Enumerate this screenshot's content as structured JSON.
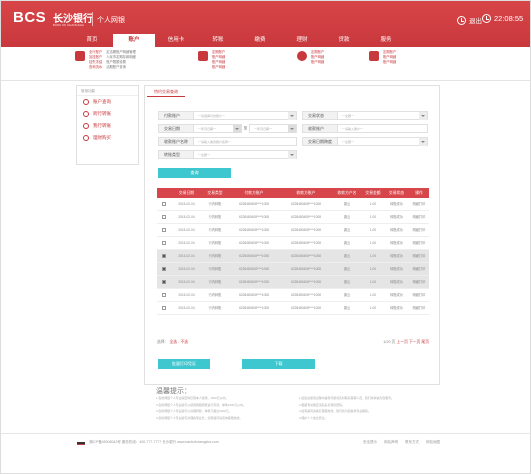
{
  "brand": {
    "logo": "BCS",
    "name_cn": "长沙银行",
    "name_en": "BANK OF CHANGSHA",
    "subtitle": "个人网银",
    "accent": "#c8383c",
    "teal": "#3fc7cf"
  },
  "header": {
    "exit_label": "退出",
    "time": "22:08:55"
  },
  "nav": {
    "items": [
      {
        "label": "首页"
      },
      {
        "label": "账户"
      },
      {
        "label": "信用卡"
      },
      {
        "label": "转账"
      },
      {
        "label": "缴费"
      },
      {
        "label": "理财"
      },
      {
        "label": "贷款"
      },
      {
        "label": "服务"
      }
    ],
    "active": 1
  },
  "submenu": {
    "group1_a": [
      "全行账户",
      "加挂账户",
      "挂失冻结",
      "查询流水"
    ],
    "group1_b": [
      "定活期账户明细管理",
      "人民币定期存款明细",
      "账户限额设置",
      "活期账户查询"
    ],
    "group2": [
      "定期账户",
      "账户明细",
      "账户明细",
      "账户明细"
    ],
    "group3": [
      "定期账户",
      "账户明细",
      "账户明细"
    ],
    "group4": [
      "定期账户",
      "账户明细",
      "账户明细"
    ]
  },
  "sidebar": {
    "title": "常用功能",
    "items": [
      {
        "label": "账户查询"
      },
      {
        "label": "跨行转账"
      },
      {
        "label": "我行转账"
      },
      {
        "label": "理财购买"
      }
    ]
  },
  "main": {
    "tab_label": "特约交易查询",
    "form": {
      "payer_label": "付款账户",
      "payer_placeholder": "一请选择付款账户一",
      "status_label": "交易状态",
      "status_placeholder": "一全部一",
      "date_label": "交易日期",
      "date_from_placeholder": "一年月日期一",
      "date_to_placeholder": "一年月日期一",
      "date_sep": "至",
      "payee_label": "收款账户",
      "payee_placeholder": "一请输入账户一",
      "payee_name_label": "收款账户名称",
      "payee_name_placeholder": "一请输入收款账户名称一",
      "date_period_label": "交易日期跨度",
      "date_period_placeholder": "一全部一",
      "transfer_type_label": "转账类型",
      "transfer_type_placeholder": "一全部一",
      "query_button": "查询"
    },
    "table": {
      "headers": [
        "交易日期",
        "交易类型",
        "付款方账户",
        "收款方账户",
        "收款方户名",
        "交易金额",
        "交易状态",
        "操作"
      ],
      "rows": [
        {
          "date": "2015-02-04",
          "type": "行内转账",
          "payer": "6228480408****1008",
          "payee": "6228480408****1008",
          "name": "唐云",
          "amount": "1.00",
          "status": "转账成功",
          "op": "明细打印",
          "checked": false
        },
        {
          "date": "2015-02-04",
          "type": "行内转账",
          "payer": "6228480408****1008",
          "payee": "6228480408****1008",
          "name": "唐云",
          "amount": "1.00",
          "status": "转账成功",
          "op": "明细打印",
          "checked": false
        },
        {
          "date": "2015-02-04",
          "type": "行内转账",
          "payer": "6228480408****1008",
          "payee": "6228480408****1008",
          "name": "唐云",
          "amount": "1.00",
          "status": "转账成功",
          "op": "明细打印",
          "checked": false
        },
        {
          "date": "2015-02-04",
          "type": "行内转账",
          "payer": "6228480408****1008",
          "payee": "6228480408****1008",
          "name": "唐云",
          "amount": "1.00",
          "status": "转账成功",
          "op": "明细打印",
          "checked": false
        },
        {
          "date": "2015-02-04",
          "type": "行内转账",
          "payer": "6228480408****1008",
          "payee": "6228480408****1008",
          "name": "唐云",
          "amount": "1.00",
          "status": "转账成功",
          "op": "明细打印",
          "checked": true
        },
        {
          "date": "2015-02-04",
          "type": "行内转账",
          "payer": "6228480408****1008",
          "payee": "6228480408****1008",
          "name": "唐云",
          "amount": "1.00",
          "status": "转账成功",
          "op": "明细打印",
          "checked": true
        },
        {
          "date": "2015-02-04",
          "type": "行内转账",
          "payer": "6228480408****1008",
          "payee": "6228480408****1008",
          "name": "唐云",
          "amount": "1.00",
          "status": "转账成功",
          "op": "明细打印",
          "checked": true
        },
        {
          "date": "2015-02-04",
          "type": "行内转账",
          "payer": "6228480408****1008",
          "payee": "6228480408****1008",
          "name": "唐云",
          "amount": "1.00",
          "status": "转账成功",
          "op": "明细打印",
          "checked": false
        },
        {
          "date": "2015-02-04",
          "type": "行内转账",
          "payer": "6228480408****1008",
          "payee": "6228480408****1008",
          "name": "唐云",
          "amount": "1.00",
          "status": "转账成功",
          "op": "明细打印",
          "checked": false
        }
      ]
    },
    "pager": {
      "select_label": "选择：",
      "select_all": "全选",
      "select_none": "不选",
      "page_info": "1/20 页",
      "prev": "上一页",
      "next": "下一页",
      "last": "尾页"
    },
    "buttons": {
      "batch_print": "批量打印凭证",
      "download": "下载"
    }
  },
  "tips": {
    "title": "温馨提示：",
    "col1": [
      "1.您的网银个人专业版密码仅限本人使用，1000元以内。",
      "2.您的网银个人专业版可以使用网银转账进行存款，单笔1000元以内。",
      "3.您的网银个人专业版可以办理转账，单笔不超过1000元。",
      "4.您的网银个人专业版可办理各项业务，如有疑问请咨询客服热线。"
    ],
    "col2": [
      "1.如您在使用过程中遇到问题请及时联系客服人员，我们将竭诚为您服务。",
      "2.根据有关规定请您妥善保管密码。",
      "3.如有疑问请拨打客服热线，我们将为您提供专业解答。",
      "4.保护个人信息安全。"
    ]
  },
  "footer": {
    "left": "湘ICP备05008043号   服务热线：400-777-7777   长沙银行 www.bankofchangsha.com",
    "links": [
      "安全提示",
      "网站声明",
      "联系方式",
      "网站地图"
    ]
  }
}
